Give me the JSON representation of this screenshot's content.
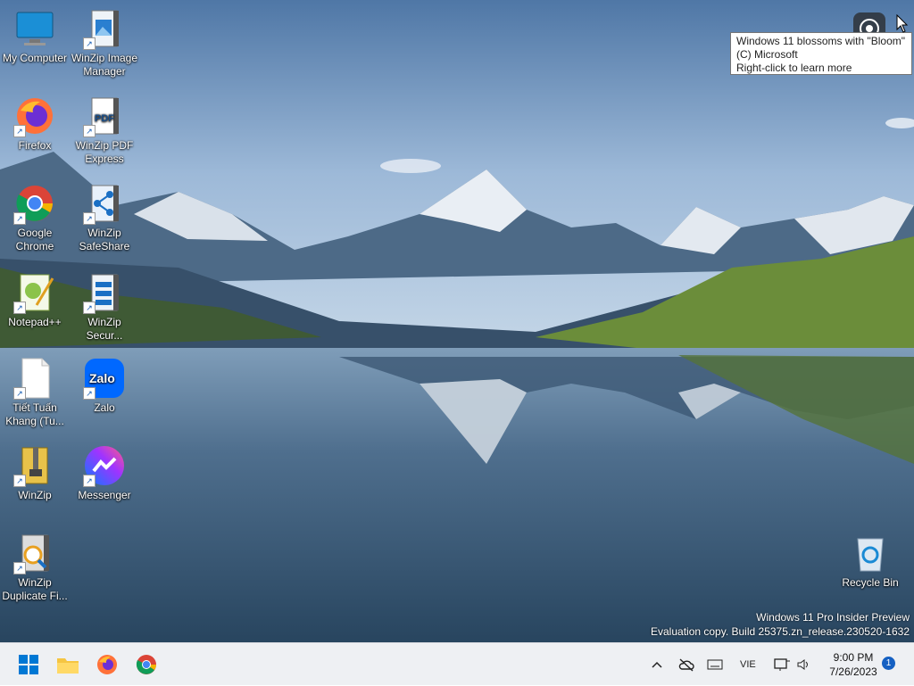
{
  "desktop_icons": [
    {
      "label": "My Computer",
      "icon": "monitor-icon"
    },
    {
      "label": "WinZip Image Manager",
      "icon": "winzip-image-icon"
    },
    {
      "label": "Firefox",
      "icon": "firefox-icon"
    },
    {
      "label": "WinZip PDF Express",
      "icon": "winzip-pdf-icon"
    },
    {
      "label": "Google Chrome",
      "icon": "chrome-icon"
    },
    {
      "label": "WinZip SafeShare",
      "icon": "winzip-safeshare-icon"
    },
    {
      "label": "Notepad++",
      "icon": "notepadpp-icon"
    },
    {
      "label": "WinZip Secur...",
      "icon": "winzip-secure-icon"
    },
    {
      "label": "Tiết Tuấn Khang (Tu...",
      "icon": "document-icon"
    },
    {
      "label": "Zalo",
      "icon": "zalo-icon"
    },
    {
      "label": "WinZip",
      "icon": "winzip-icon"
    },
    {
      "label": "Messenger",
      "icon": "messenger-icon"
    },
    {
      "label": "WinZip Duplicate Fi...",
      "icon": "winzip-duplicate-icon"
    },
    {
      "label": "Recycle Bin",
      "icon": "recycle-bin-icon"
    }
  ],
  "icon_glyphs": {
    "pdf": "PDF",
    "zalo": "Zalo",
    "shortcut": "↗"
  },
  "tooltip": {
    "line1": "Windows 11 blossoms with \"Bloom\"",
    "line2": "(C) Microsoft",
    "line3": "Right-click to learn more"
  },
  "watermark": {
    "line1": "Windows 11 Pro Insider Preview",
    "line2": "Evaluation copy. Build 25375.zn_release.230520-1632"
  },
  "taskbar": {
    "pinned": [
      "start-icon",
      "file-explorer-icon",
      "firefox-icon",
      "chrome-icon"
    ],
    "tray": {
      "language": "VIE",
      "time": "9:00 PM",
      "date": "7/26/2023",
      "notification_count": "1"
    }
  },
  "colors": {
    "accent": "#0067c0",
    "taskbar_bg": "#eef0f3"
  }
}
